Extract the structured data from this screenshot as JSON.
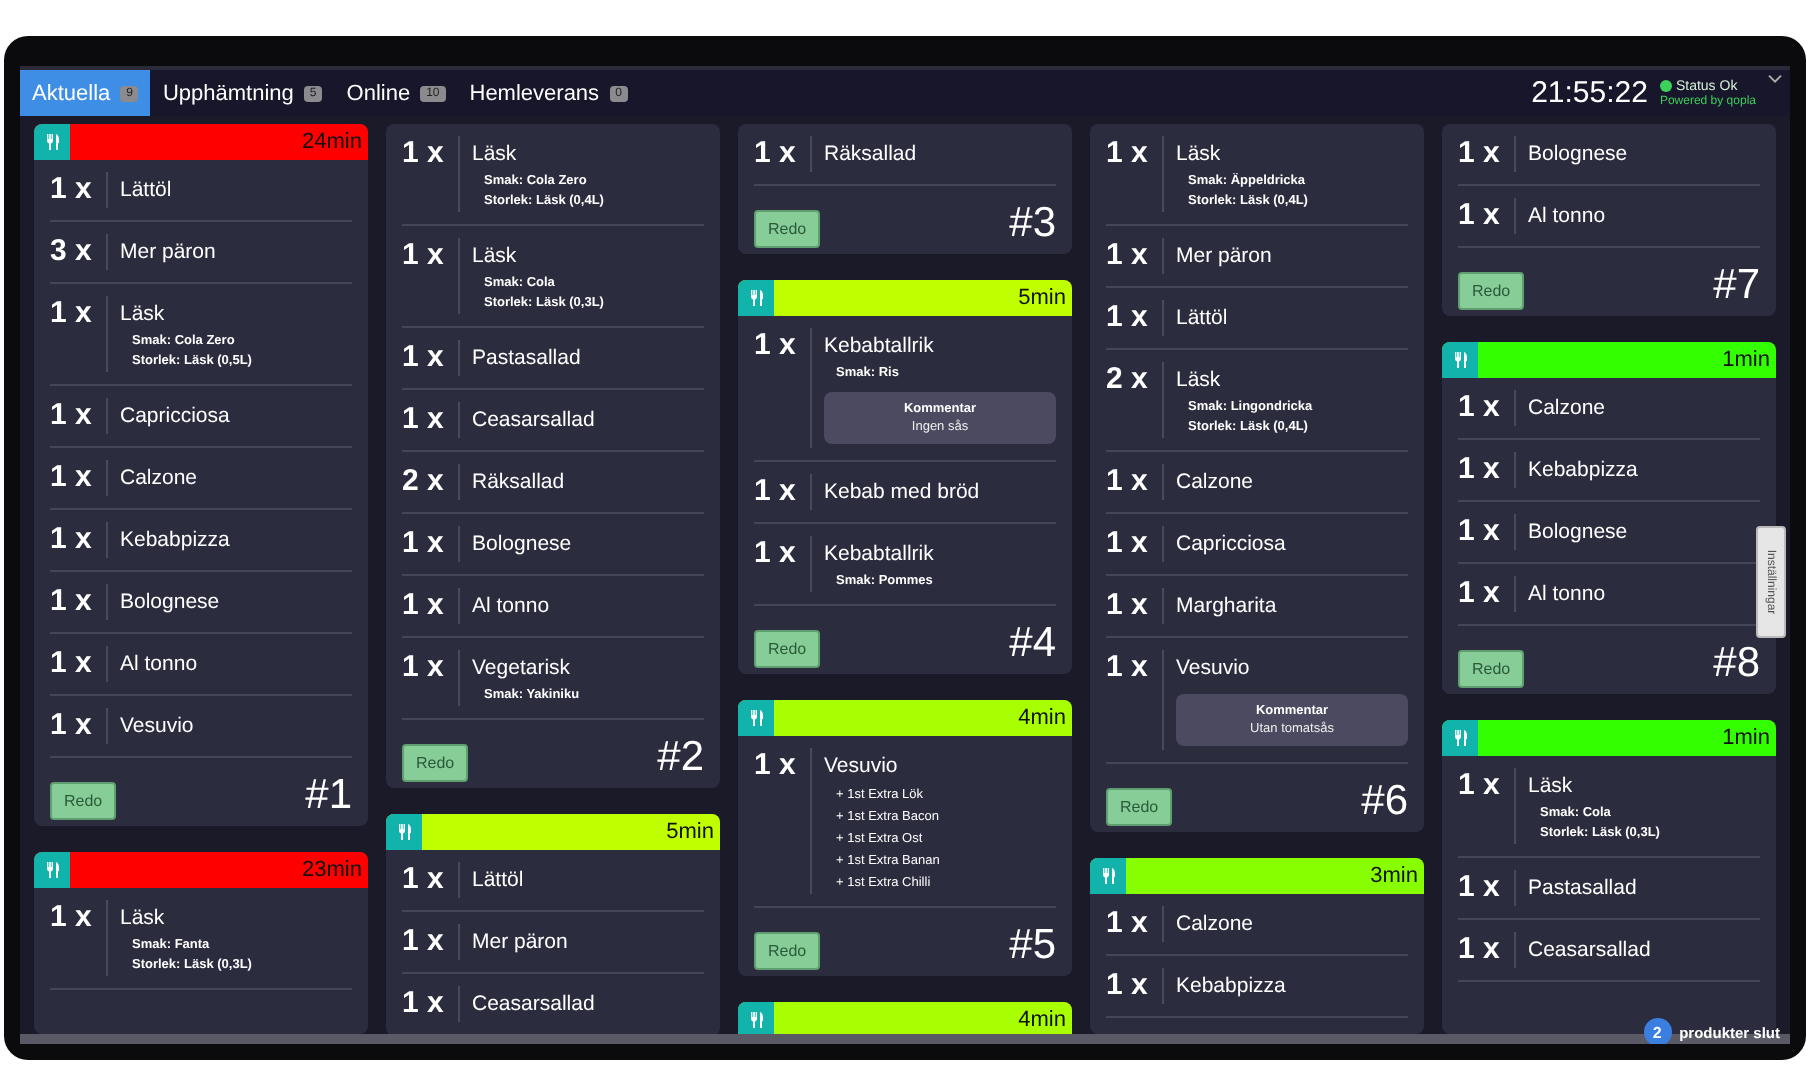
{
  "tabs": [
    {
      "label": "Aktuella",
      "count": "9",
      "selected": true
    },
    {
      "label": "Upphämtning",
      "count": "5",
      "selected": false
    },
    {
      "label": "Online",
      "count": "10",
      "selected": false
    },
    {
      "label": "Hemleverans",
      "count": "0",
      "selected": false
    }
  ],
  "clock": "21:55:22",
  "status": "Status Ok",
  "powered_by": "Powered by qopla",
  "columns": [
    {
      "cards": [
        {
          "timer": "24min",
          "color": "#ff0000",
          "items": [
            {
              "qty": "1 x",
              "name": "Lättöl"
            },
            {
              "qty": "3 x",
              "name": "Mer päron"
            },
            {
              "qty": "1 x",
              "name": "Läsk",
              "details": [
                "Smak: Cola Zero",
                "Storlek: Läsk (0,5L)"
              ]
            },
            {
              "qty": "1 x",
              "name": "Capricciosa"
            },
            {
              "qty": "1 x",
              "name": "Calzone"
            },
            {
              "qty": "1 x",
              "name": "Kebabpizza"
            },
            {
              "qty": "1 x",
              "name": "Bolognese"
            },
            {
              "qty": "1 x",
              "name": "Al tonno"
            },
            {
              "qty": "1 x",
              "name": "Vesuvio"
            }
          ],
          "button": "Redo",
          "number": "#1"
        },
        {
          "timer": "23min",
          "color": "#ff0000",
          "items": [
            {
              "qty": "1 x",
              "name": "Läsk",
              "details": [
                "Smak: Fanta",
                "Storlek: Läsk (0,3L)"
              ]
            }
          ]
        }
      ]
    },
    {
      "cards": [
        {
          "items": [
            {
              "qty": "1 x",
              "name": "Läsk",
              "details": [
                "Smak: Cola Zero",
                "Storlek: Läsk (0,4L)"
              ]
            },
            {
              "qty": "1 x",
              "name": "Läsk",
              "details": [
                "Smak: Cola",
                "Storlek: Läsk (0,3L)"
              ]
            },
            {
              "qty": "1 x",
              "name": "Pastasallad"
            },
            {
              "qty": "1 x",
              "name": "Ceasarsallad"
            },
            {
              "qty": "2 x",
              "name": "Räksallad"
            },
            {
              "qty": "1 x",
              "name": "Bolognese"
            },
            {
              "qty": "1 x",
              "name": "Al tonno"
            },
            {
              "qty": "1 x",
              "name": "Vegetarisk",
              "details": [
                "Smak: Yakiniku"
              ]
            }
          ],
          "button": "Redo",
          "number": "#2"
        },
        {
          "timer": "5min",
          "color": "#bfff00",
          "items": [
            {
              "qty": "1 x",
              "name": "Lättöl"
            },
            {
              "qty": "1 x",
              "name": "Mer päron"
            },
            {
              "qty": "1 x",
              "name": "Ceasarsallad"
            }
          ]
        }
      ]
    },
    {
      "cards": [
        {
          "items": [
            {
              "qty": "1 x",
              "name": "Räksallad"
            }
          ],
          "button": "Redo",
          "number": "#3"
        },
        {
          "timer": "5min",
          "color": "#bfff00",
          "items": [
            {
              "qty": "1 x",
              "name": "Kebabtallrik",
              "details": [
                "Smak: Ris"
              ],
              "comment": {
                "title": "Kommentar",
                "text": "Ingen sås"
              }
            },
            {
              "qty": "1 x",
              "name": "Kebab med bröd"
            },
            {
              "qty": "1 x",
              "name": "Kebabtallrik",
              "details": [
                "Smak: Pommes"
              ]
            }
          ],
          "button": "Redo",
          "number": "#4"
        },
        {
          "timer": "4min",
          "color": "#a8ff00",
          "items": [
            {
              "qty": "1 x",
              "name": "Vesuvio",
              "details": [
                "+ 1st Extra Lök",
                "+ 1st Extra Bacon",
                "+ 1st Extra Ost",
                "+ 1st Extra Banan",
                "+ 1st Extra Chilli"
              ]
            }
          ],
          "button": "Redo",
          "number": "#5"
        },
        {
          "timer": "4min",
          "color": "#a8ff00"
        }
      ]
    },
    {
      "cards": [
        {
          "items": [
            {
              "qty": "1 x",
              "name": "Läsk",
              "details": [
                "Smak: Äppeldricka",
                "Storlek: Läsk (0,4L)"
              ]
            },
            {
              "qty": "1 x",
              "name": "Mer päron"
            },
            {
              "qty": "1 x",
              "name": "Lättöl"
            },
            {
              "qty": "2 x",
              "name": "Läsk",
              "details": [
                "Smak: Lingondricka",
                "Storlek: Läsk (0,4L)"
              ]
            },
            {
              "qty": "1 x",
              "name": "Calzone"
            },
            {
              "qty": "1 x",
              "name": "Capricciosa"
            },
            {
              "qty": "1 x",
              "name": "Margharita"
            },
            {
              "qty": "1 x",
              "name": "Vesuvio",
              "comment": {
                "title": "Kommentar",
                "text": "Utan tomatsås"
              }
            }
          ],
          "button": "Redo",
          "number": "#6"
        },
        {
          "timer": "3min",
          "color": "#88ff00",
          "items": [
            {
              "qty": "1 x",
              "name": "Calzone"
            },
            {
              "qty": "1 x",
              "name": "Kebabpizza"
            }
          ]
        }
      ]
    },
    {
      "cards": [
        {
          "items": [
            {
              "qty": "1 x",
              "name": "Bolognese"
            },
            {
              "qty": "1 x",
              "name": "Al tonno"
            }
          ],
          "button": "Redo",
          "number": "#7"
        },
        {
          "timer": "1min",
          "color": "#33ff00",
          "items": [
            {
              "qty": "1 x",
              "name": "Calzone"
            },
            {
              "qty": "1 x",
              "name": "Kebabpizza"
            },
            {
              "qty": "1 x",
              "name": "Bolognese"
            },
            {
              "qty": "1 x",
              "name": "Al tonno"
            }
          ],
          "button": "Redo",
          "number": "#8"
        },
        {
          "timer": "1min",
          "color": "#33ff00",
          "items": [
            {
              "qty": "1 x",
              "name": "Läsk",
              "details": [
                "Smak: Cola",
                "Storlek: Läsk (0,3L)"
              ]
            },
            {
              "qty": "1 x",
              "name": "Pastasallad"
            },
            {
              "qty": "1 x",
              "name": "Ceasarsallad"
            }
          ]
        }
      ]
    }
  ],
  "settings_tab": "Inställningar",
  "sold_out": {
    "count": "2",
    "label": "produkter slut"
  }
}
